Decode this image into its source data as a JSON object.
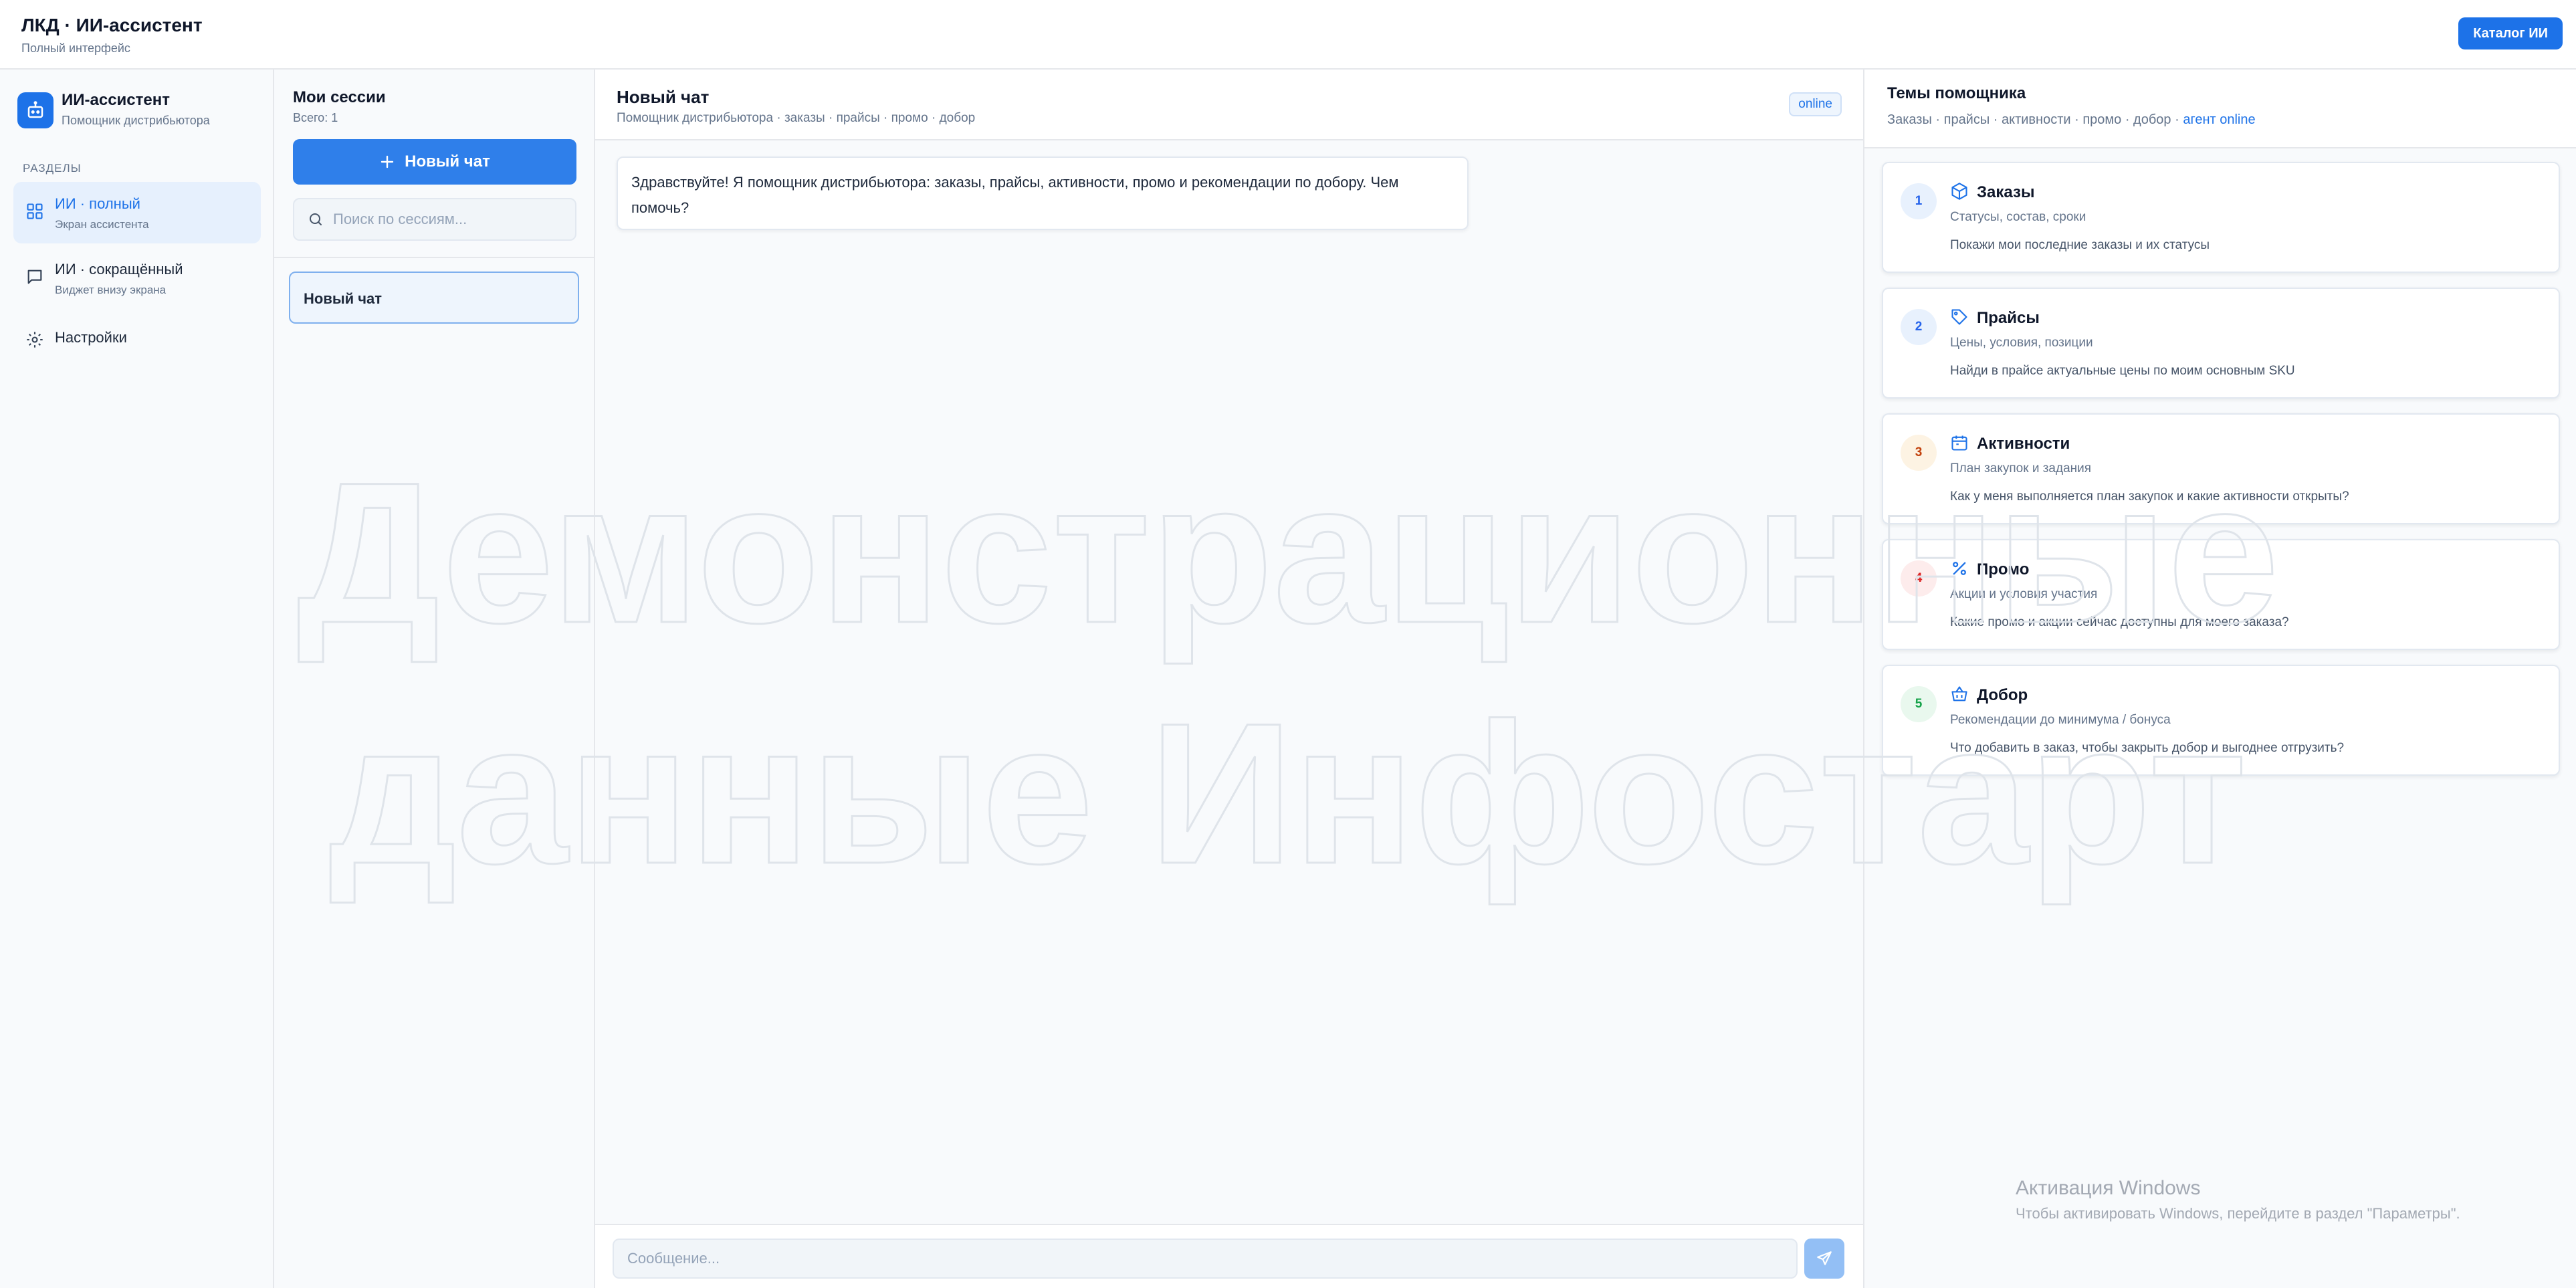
{
  "topbar": {
    "title": "ЛКД · ИИ-ассистент",
    "subtitle": "Полный интерфейс",
    "catalog_button": "Каталог ИИ"
  },
  "nav": {
    "brand_title": "ИИ-ассистент",
    "brand_subtitle": "Помощник дистрибьютора",
    "section_label": "РАЗДЕЛЫ",
    "items": [
      {
        "label": "ИИ · полный",
        "sub": "Экран ассистента",
        "icon": "grid-icon",
        "active": true
      },
      {
        "label": "ИИ · сокращённый",
        "sub": "Виджет внизу экрана",
        "icon": "chat-bubble-icon",
        "active": false
      },
      {
        "label": "Настройки",
        "sub": "",
        "icon": "gear-icon",
        "active": false
      }
    ]
  },
  "sessions": {
    "title": "Мои сессии",
    "count": "Всего: 1",
    "new_chat": "Новый чат",
    "search_placeholder": "Поиск по сессиям...",
    "items": [
      {
        "label": "Новый чат"
      }
    ]
  },
  "chat": {
    "title": "Новый чат",
    "subtitle": "Помощник дистрибьютора · заказы · прайсы · промо · добор",
    "status": "online",
    "messages": [
      {
        "text": "Здравствуйте! Я помощник дистрибьютора: заказы, прайсы, активности, промо и рекомендации по добору. Чем помочь?"
      }
    ],
    "composer_placeholder": "Сообщение..."
  },
  "topics": {
    "title": "Темы помощника",
    "subtitle": "Заказы · прайсы · активности · промо · добор ·",
    "agent_status": "агент online",
    "cards": [
      {
        "num": "1",
        "title": "Заказы",
        "sub": "Статусы, состав, сроки",
        "prompt": "Покажи мои последние заказы и их статусы",
        "icon": "box-icon",
        "num_color": "#2563eb",
        "num_bg": "#e8f1fd"
      },
      {
        "num": "2",
        "title": "Прайсы",
        "sub": "Цены, условия, позиции",
        "prompt": "Найди в прайсе актуальные цены по моим основным SKU",
        "icon": "tag-icon",
        "num_color": "#2563eb",
        "num_bg": "#e8f1fd"
      },
      {
        "num": "3",
        "title": "Активности",
        "sub": "План закупок и задания",
        "prompt": "Как у меня выполняется план закупок и какие активности открыты?",
        "icon": "calendar-icon",
        "num_color": "#c2410c",
        "num_bg": "#fdf3e3"
      },
      {
        "num": "4",
        "title": "Промо",
        "sub": "Акции и условия участия",
        "prompt": "Какие промо и акции сейчас доступны для моего заказа?",
        "icon": "percent-icon",
        "num_color": "#dc2626",
        "num_bg": "#fdecec"
      },
      {
        "num": "5",
        "title": "Добор",
        "sub": "Рекомендации до минимума / бонуса",
        "prompt": "Что добавить в заказ, чтобы закрыть добор и выгоднее отгрузить?",
        "icon": "basket-icon",
        "num_color": "#16a34a",
        "num_bg": "#e9f8ee"
      }
    ]
  },
  "watermark": {
    "line1": "Демонстрационные",
    "line2": "данные Инфостарт"
  },
  "windows_activation": {
    "title": "Активация Windows",
    "subtitle": "Чтобы активировать Windows, перейдите в раздел \"Параметры\"."
  },
  "colors": {
    "accent": "#1d72e8",
    "active_bg": "#e6f0fd",
    "border": "#e5e7eb"
  }
}
